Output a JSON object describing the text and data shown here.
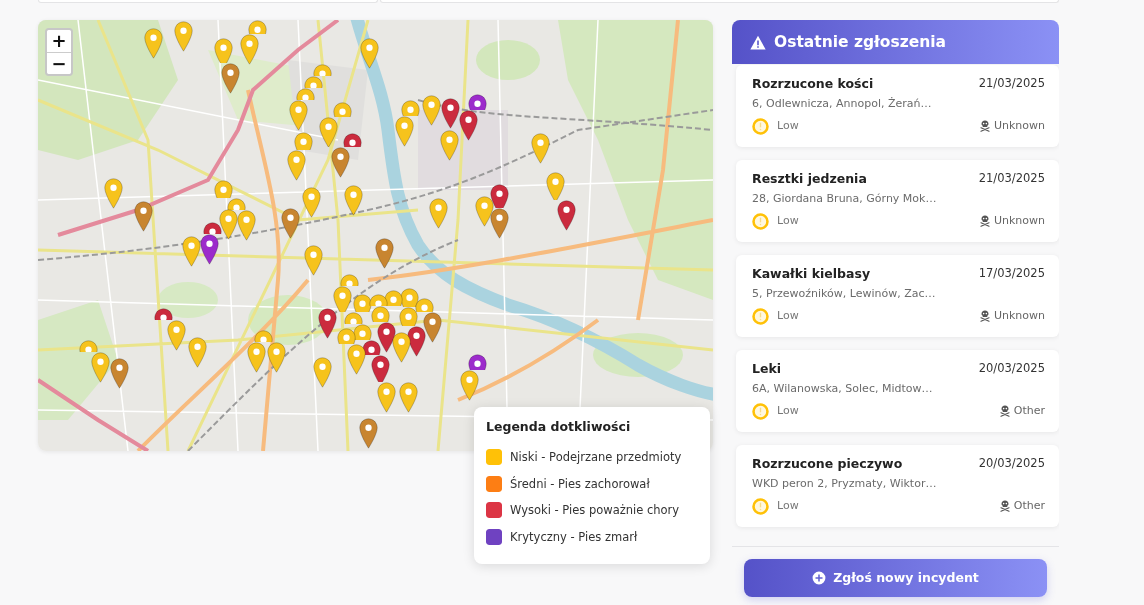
{
  "map": {
    "zoom_controls": [
      "+",
      "−"
    ],
    "markers": [
      {
        "color": "#f6c31c"
      },
      {
        "color": "#f6c31c"
      },
      {
        "color": "#f6c31c"
      },
      {
        "color": "#f6c31c"
      },
      {
        "color": "#f6c31c"
      },
      {
        "color": "#c88530"
      },
      {
        "color": "#f6c31c"
      },
      {
        "color": "#f6c31c"
      },
      {
        "color": "#f6c31c"
      },
      {
        "color": "#f6c31c"
      },
      {
        "color": "#f6c31c"
      },
      {
        "color": "#f6c31c"
      },
      {
        "color": "#f6c31c"
      },
      {
        "color": "#cb2b3e"
      },
      {
        "color": "#c88530"
      },
      {
        "color": "#f6c31c"
      },
      {
        "color": "#f6c31c"
      },
      {
        "color": "#f6c31c"
      },
      {
        "color": "#c88530"
      },
      {
        "color": "#f6c31c"
      },
      {
        "color": "#f6c31c"
      },
      {
        "color": "#f6c31c"
      },
      {
        "color": "#f6c31c"
      },
      {
        "color": "#c88530"
      },
      {
        "color": "#f6c31c"
      },
      {
        "color": "#f6c31c"
      },
      {
        "color": "#cb2b3e"
      },
      {
        "color": "#f6c31c"
      },
      {
        "color": "#9c2bcb"
      },
      {
        "color": "#f6c31c"
      },
      {
        "color": "#f6c31c"
      },
      {
        "color": "#f6c31c"
      },
      {
        "color": "#cb2b3e"
      },
      {
        "color": "#9c2bcb"
      },
      {
        "color": "#cb2b3e"
      },
      {
        "color": "#f6c31c"
      },
      {
        "color": "#f6c31c"
      },
      {
        "color": "#f6c31c"
      },
      {
        "color": "#cb2b3e"
      },
      {
        "color": "#cb2b3e"
      },
      {
        "color": "#f6c31c"
      },
      {
        "color": "#c88530"
      },
      {
        "color": "#f6c31c"
      },
      {
        "color": "#f6c31c"
      },
      {
        "color": "#c88530"
      },
      {
        "color": "#f6c31c"
      },
      {
        "color": "#f6c31c"
      },
      {
        "color": "#f6c31c"
      },
      {
        "color": "#cb2b3e"
      },
      {
        "color": "#f6c31c"
      },
      {
        "color": "#f6c31c"
      },
      {
        "color": "#f6c31c"
      },
      {
        "color": "#f6c31c"
      },
      {
        "color": "#f6c31c"
      },
      {
        "color": "#f6c31c"
      },
      {
        "color": "#c88530"
      },
      {
        "color": "#f6c31c"
      },
      {
        "color": "#f6c31c"
      },
      {
        "color": "#f6c31c"
      },
      {
        "color": "#cb2b3e"
      },
      {
        "color": "#f6c31c"
      },
      {
        "color": "#cb2b3e"
      },
      {
        "color": "#f6c31c"
      },
      {
        "color": "#cb2b3e"
      },
      {
        "color": "#cb2b3e"
      },
      {
        "color": "#cb2b3e"
      },
      {
        "color": "#f6c31c"
      },
      {
        "color": "#f6c31c"
      },
      {
        "color": "#f6c31c"
      },
      {
        "color": "#f6c31c"
      },
      {
        "color": "#c88530"
      },
      {
        "color": "#f6c31c"
      },
      {
        "color": "#f6c31c"
      },
      {
        "color": "#f6c31c"
      },
      {
        "color": "#f6c31c"
      },
      {
        "color": "#f6c31c"
      },
      {
        "color": "#f6c31c"
      },
      {
        "color": "#c88530"
      },
      {
        "color": "#9c2bcb"
      },
      {
        "color": "#f6c31c"
      }
    ]
  },
  "legend": {
    "title": "Legenda dotkliwości",
    "items": [
      {
        "label": "Niski - Podejrzane przedmioty",
        "color": "#ffc107"
      },
      {
        "label": "Średni - Pies zachorował",
        "color": "#fd7e14"
      },
      {
        "label": "Wysoki - Pies poważnie chory",
        "color": "#dc3545"
      },
      {
        "label": "Krytyczny - Pies zmarł",
        "color": "#6f42c1"
      }
    ]
  },
  "recent_reports": {
    "title": "Ostatnie zgłoszenia",
    "items": [
      {
        "title": "Rozrzucone kości",
        "date": "21/03/2025",
        "address": "6, Odlewnicza, Annopol, Żerań…",
        "severity": "Low",
        "color": "#ffc107",
        "cause": "Unknown"
      },
      {
        "title": "Resztki jedzenia",
        "date": "21/03/2025",
        "address": "28, Giordana Bruna, Górny Mok…",
        "severity": "Low",
        "color": "#ffc107",
        "cause": "Unknown"
      },
      {
        "title": "Kawałki kielbasy",
        "date": "17/03/2025",
        "address": "5, Przewoźników, Lewinów, Zac…",
        "severity": "Low",
        "color": "#ffc107",
        "cause": "Unknown"
      },
      {
        "title": "Leki",
        "date": "20/03/2025",
        "address": "6A, Wilanowska, Solec, Midtow…",
        "severity": "Low",
        "color": "#ffc107",
        "cause": "Other"
      },
      {
        "title": "Rozrzucone pieczywo",
        "date": "20/03/2025",
        "address": "WKD peron 2, Pryzmaty, Wiktor…",
        "severity": "Low",
        "color": "#ffc107",
        "cause": "Other"
      }
    ],
    "button": "Zgłoś nowy incydent"
  }
}
